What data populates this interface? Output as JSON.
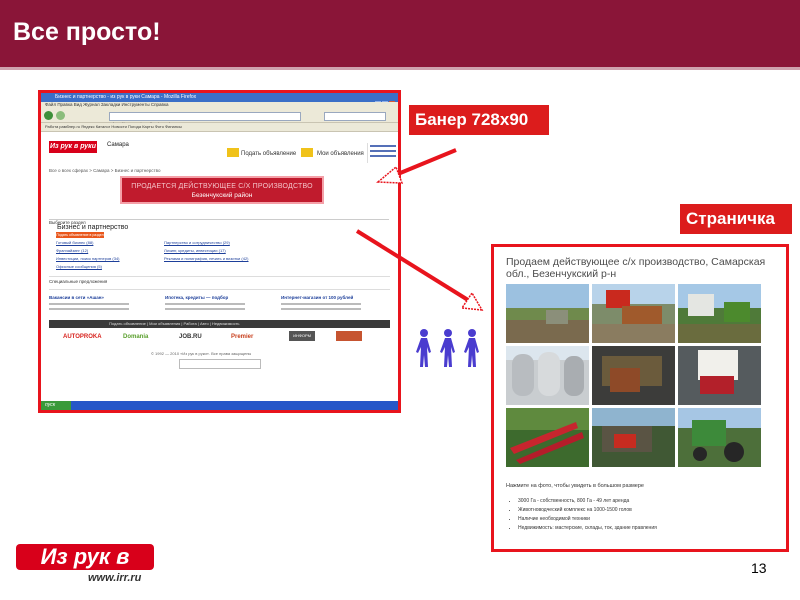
{
  "slide": {
    "title": "Все просто!",
    "page_number": "13"
  },
  "callouts": {
    "banner": "Банер 728х90",
    "page": "Страничка"
  },
  "screenshot": {
    "window_title": "Бизнес и партнерство - из рук в руки Самара - Mozilla Firefox",
    "menu": "Файл  Правка  Вид  Журнал  Закладки  Инструменты  Справка",
    "url": "http://samara.irr.ru/business/",
    "bookmarks": "Работа   рамблер.ru   Яндекс   Каталог   Новости   Погода   Карты   Фото   Финансы",
    "site_logo": "Из рук в руки",
    "city": "Самара",
    "post_ad": "Подать объявление",
    "my_ads": "Мои объявления",
    "breadcrumb": "Все о всех сферах > Самара > Бизнес и партнерство",
    "banner_line1": "ПРОДАЕТСЯ ДЕЙСТВУЮЩЕЕ С/Х ПРОИЗВОДСТВО",
    "banner_line2": "Безенчукский район",
    "tabs": "Выберите раздел",
    "section_title": "Бизнес и партнерство",
    "section_button": "Подать объявление в раздел",
    "links_left": [
      "Готовый бизнес (88)",
      "Франчайзинг (12)",
      "Инвестиции, поиск партнеров (34)",
      "Офисные сообщения (5)"
    ],
    "links_right": [
      "Партнерство и сотрудничество (29)",
      "Лизинг, кредиты, инвестиции (17)",
      "Реклама и полиграфия, печать и визитки (42)"
    ],
    "specials": "Специальные предложения",
    "promos": [
      "Вакансии в сети «Ашан»",
      "Ипотека, кредиты — подбор",
      "Интернет-магазин от 100 рублей"
    ],
    "footer_bar": "Подать объявление | Мои объявления | Работа | Авто | Недвижимость",
    "partners": [
      "AUTOPROKA",
      "Domania",
      "JOB.RU",
      "Premier",
      "ИНФОРМ"
    ],
    "footer": "© 1992 — 2010 «Из рук в руки». Все права защищены",
    "start": "пуск"
  },
  "page": {
    "title": "Продаем действующее с/х производство, Самарская обл., Безенчукский р-н",
    "caption": "Нажмите на фото, чтобы увидеть в большом размере",
    "bullets": [
      "3000 Га - собственность, 800 Га - 49 лет аренда",
      "Животноводческий комплекс на 1000-1500 голов",
      "Наличие необходимой техники",
      "Недвижимость: мастерские, склады, ток, здание правления"
    ]
  },
  "logo": {
    "main": "Из рук в руки",
    "url": "www.irr.ru"
  },
  "colors": {
    "brand": "#8a1538",
    "accent": "#dc1c1c",
    "frame": "#e8141d"
  }
}
